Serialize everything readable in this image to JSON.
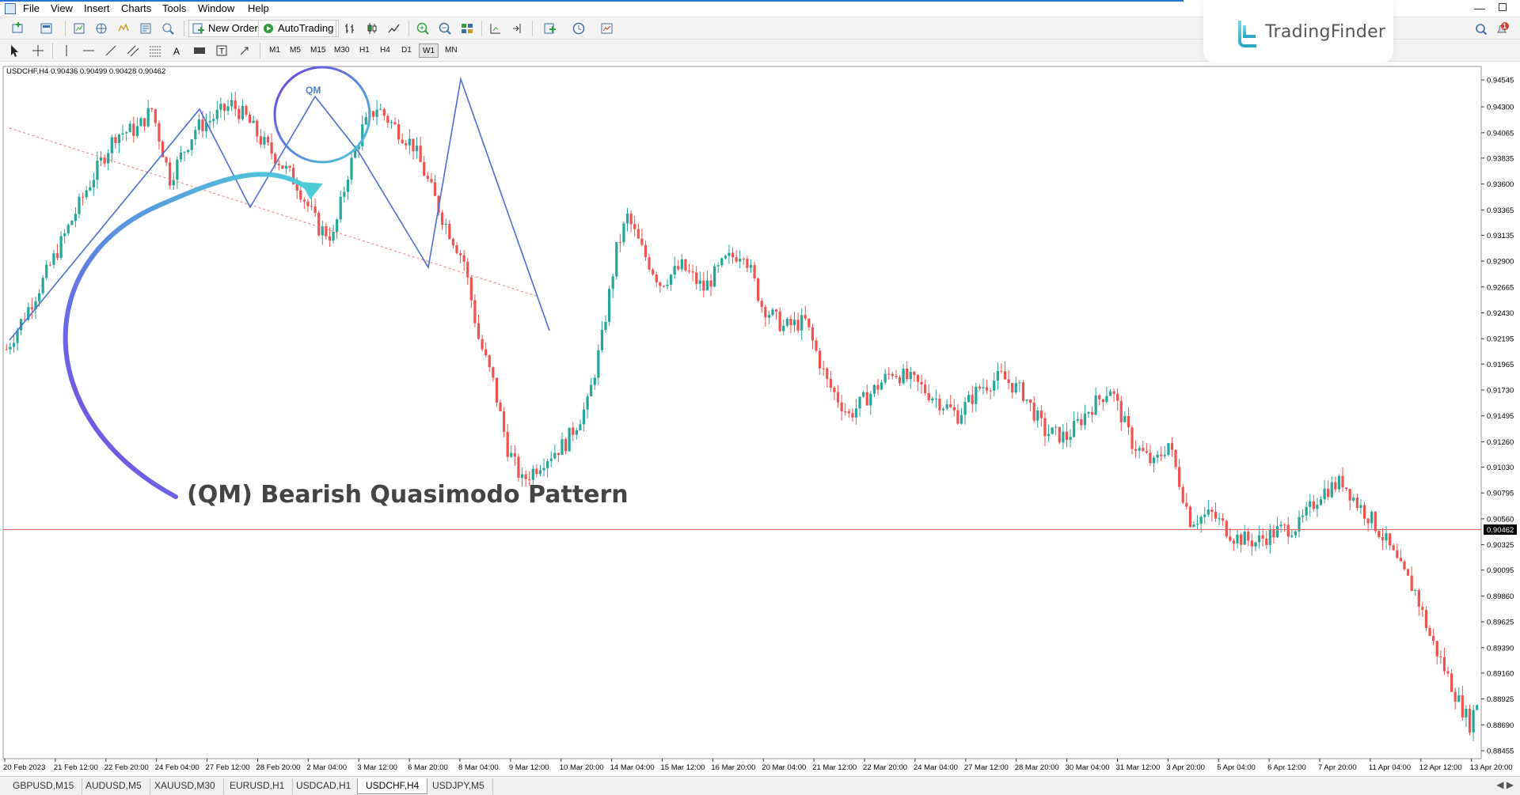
{
  "menu": {
    "items": [
      "File",
      "View",
      "Insert",
      "Charts",
      "Tools",
      "Window",
      "Help"
    ]
  },
  "toolbar": {
    "new_order_label": "New Order",
    "autotrading_label": "AutoTrading",
    "timeframes": [
      "M1",
      "M5",
      "M15",
      "M30",
      "H1",
      "H4",
      "D1",
      "W1",
      "MN"
    ],
    "active_timeframe": "W1"
  },
  "logo": {
    "name": "TradingFinder"
  },
  "notification_count": "1",
  "chart": {
    "header": "USDCHF,H4  0.90436 0.90499 0.90428 0.90462",
    "annotation_title": "(QM) Bearish Quasimodo Pattern",
    "qm_label": "QM",
    "current_price": "0.90462",
    "colors": {
      "bull": "#26a69a",
      "bear": "#ef5350",
      "pattern": "#4a6fd1",
      "arrow_start": "#7b3fe4",
      "arrow_end": "#4ecbd8",
      "price_line": "#e06a6a",
      "trend_dash": "#e87c7c"
    }
  },
  "chart_data": {
    "type": "candlestick",
    "symbol": "USDCHF",
    "timeframe": "H4",
    "y_ticks": [
      "0.94545",
      "0.94300",
      "0.94065",
      "0.93835",
      "0.93600",
      "0.93365",
      "0.93135",
      "0.92900",
      "0.92665",
      "0.92430",
      "0.92195",
      "0.91965",
      "0.91730",
      "0.91495",
      "0.91260",
      "0.91030",
      "0.90795",
      "0.90560",
      "0.90325",
      "0.90095",
      "0.89860",
      "0.89625",
      "0.89390",
      "0.89160",
      "0.88925",
      "0.88690",
      "0.88455"
    ],
    "ylim": [
      0.88455,
      0.94545
    ],
    "x_ticks": [
      "20 Feb 2023",
      "21 Feb 12:00",
      "22 Feb 20:00",
      "24 Feb 04:00",
      "27 Feb 12:00",
      "28 Feb 20:00",
      "2 Mar 04:00",
      "3 Mar 12:00",
      "6 Mar 20:00",
      "8 Mar 04:00",
      "9 Mar 12:00",
      "10 Mar 20:00",
      "14 Mar 04:00",
      "15 Mar 12:00",
      "16 Mar 20:00",
      "20 Mar 04:00",
      "21 Mar 12:00",
      "22 Mar 20:00",
      "24 Mar 04:00",
      "27 Mar 12:00",
      "28 Mar 20:00",
      "30 Mar 04:00",
      "31 Mar 12:00",
      "3 Apr 20:00",
      "5 Apr 04:00",
      "6 Apr 12:00",
      "7 Apr 20:00",
      "11 Apr 04:00",
      "12 Apr 12:00",
      "13 Apr 20:00"
    ],
    "anchors": [
      [
        0,
        0.921
      ],
      [
        10,
        0.9272
      ],
      [
        22,
        0.9355
      ],
      [
        30,
        0.9405
      ],
      [
        36,
        0.941
      ],
      [
        40,
        0.9428
      ],
      [
        45,
        0.9365
      ],
      [
        48,
        0.9385
      ],
      [
        52,
        0.941
      ],
      [
        56,
        0.9418
      ],
      [
        62,
        0.9432
      ],
      [
        66,
        0.942
      ],
      [
        70,
        0.94
      ],
      [
        74,
        0.9385
      ],
      [
        80,
        0.936
      ],
      [
        86,
        0.932
      ],
      [
        90,
        0.9312
      ],
      [
        94,
        0.937
      ],
      [
        98,
        0.941
      ],
      [
        102,
        0.943
      ],
      [
        106,
        0.9415
      ],
      [
        112,
        0.9395
      ],
      [
        120,
        0.933
      ],
      [
        126,
        0.929
      ],
      [
        130,
        0.922
      ],
      [
        134,
        0.918
      ],
      [
        138,
        0.912
      ],
      [
        142,
        0.909
      ],
      [
        148,
        0.911
      ],
      [
        154,
        0.9125
      ],
      [
        160,
        0.916
      ],
      [
        164,
        0.922
      ],
      [
        168,
        0.93
      ],
      [
        171,
        0.933
      ],
      [
        175,
        0.93
      ],
      [
        180,
        0.927
      ],
      [
        186,
        0.9285
      ],
      [
        192,
        0.9265
      ],
      [
        198,
        0.929
      ],
      [
        203,
        0.93
      ],
      [
        208,
        0.925
      ],
      [
        214,
        0.923
      ],
      [
        220,
        0.9235
      ],
      [
        226,
        0.918
      ],
      [
        232,
        0.915
      ],
      [
        238,
        0.917
      ],
      [
        244,
        0.919
      ],
      [
        250,
        0.918
      ],
      [
        256,
        0.9165
      ],
      [
        262,
        0.915
      ],
      [
        268,
        0.9175
      ],
      [
        274,
        0.9185
      ],
      [
        280,
        0.917
      ],
      [
        286,
        0.9135
      ],
      [
        292,
        0.913
      ],
      [
        298,
        0.9155
      ],
      [
        304,
        0.9175
      ],
      [
        310,
        0.9125
      ],
      [
        316,
        0.9105
      ],
      [
        320,
        0.9125
      ],
      [
        326,
        0.9055
      ],
      [
        332,
        0.906
      ],
      [
        338,
        0.904
      ],
      [
        344,
        0.9035
      ],
      [
        350,
        0.9045
      ],
      [
        356,
        0.905
      ],
      [
        362,
        0.908
      ],
      [
        368,
        0.909
      ],
      [
        372,
        0.907
      ],
      [
        376,
        0.9055
      ],
      [
        380,
        0.9035
      ],
      [
        384,
        0.901
      ],
      [
        388,
        0.899
      ],
      [
        392,
        0.895
      ],
      [
        396,
        0.892
      ],
      [
        400,
        0.889
      ],
      [
        403,
        0.887
      ],
      [
        405,
        0.889
      ]
    ]
  }
}
